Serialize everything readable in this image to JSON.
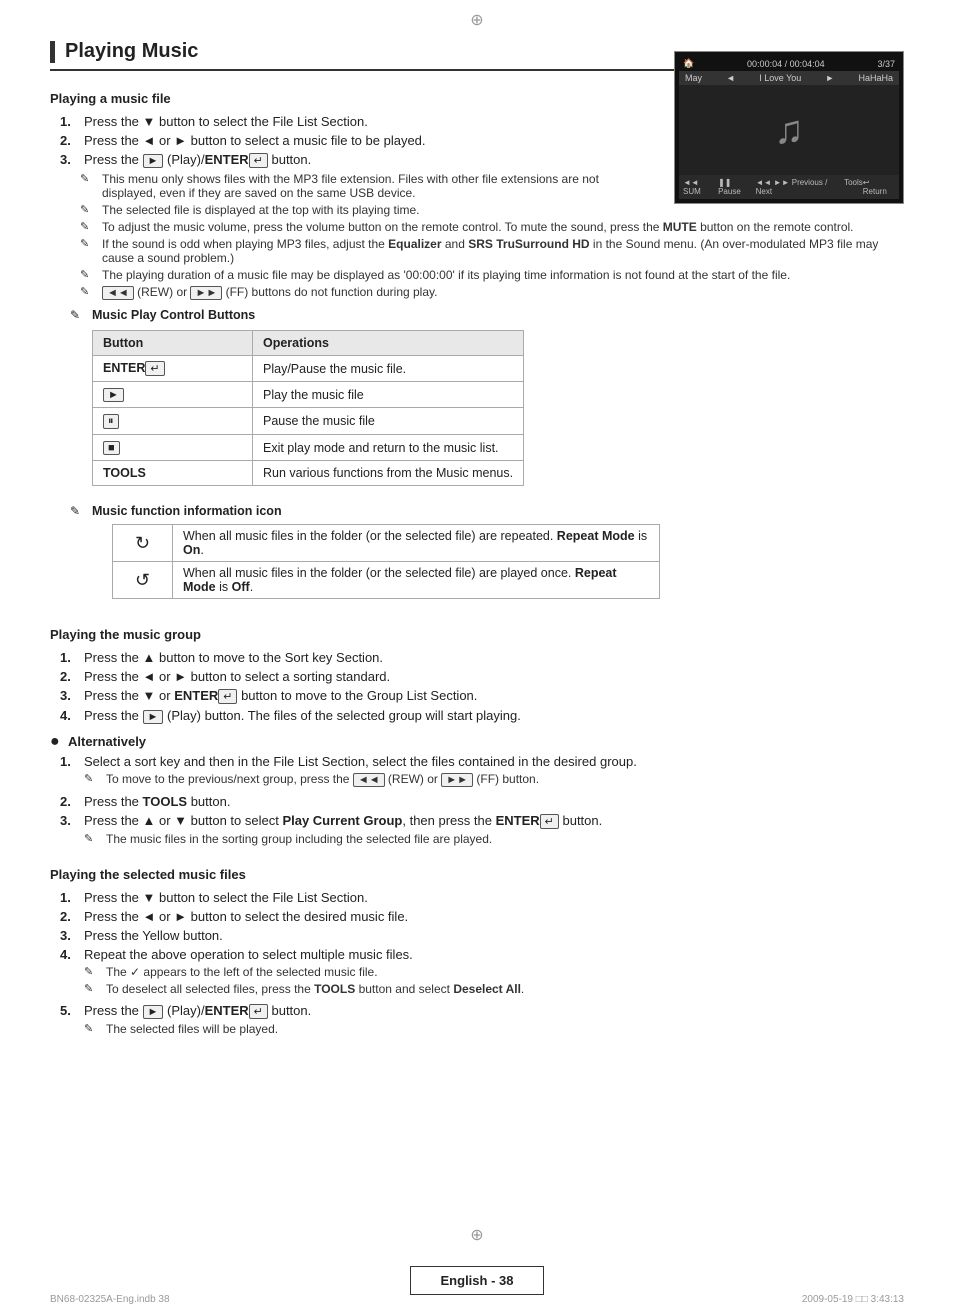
{
  "page": {
    "title": "Playing Music",
    "crosshair_symbol": "⊕",
    "footer": {
      "label": "English - 38",
      "meta_left": "BN68-02325A-Eng.indb   38",
      "meta_right": "2009-05-19   □□ 3:43:13"
    }
  },
  "sections": {
    "playing_music_file": {
      "title": "Playing a music file",
      "steps": [
        {
          "num": "1.",
          "text": "Press the ▼ button to select the File List Section."
        },
        {
          "num": "2.",
          "text": "Press the ◄ or ► button to select a music file to be played."
        },
        {
          "num": "3.",
          "text": "Press the  (Play)/ENTER  button."
        }
      ],
      "notes": [
        "This menu only shows files with the MP3 file extension. Files with other file extensions are not displayed, even if they are saved on the same USB device.",
        "The selected file is displayed at the top with its playing time.",
        "To adjust the music volume, press the volume button on the remote control. To mute the sound, press the MUTE button on the remote control.",
        "If the sound is odd when playing MP3 files, adjust the Equalizer and SRS TruSurround HD in the Sound menu. (An over-modulated MP3 file may cause a sound problem.)",
        "The playing duration of a music file may be displayed as '00:00:00' if its playing time information is not found at the start of the file.",
        " (REW) or  (FF) buttons do not function during play."
      ]
    },
    "music_play_control": {
      "title": "Music Play Control Buttons",
      "table_headers": [
        "Button",
        "Operations"
      ],
      "table_rows": [
        {
          "button": "ENTER",
          "operation": "Play/Pause the music file."
        },
        {
          "button": "▶",
          "operation": "Play the music file"
        },
        {
          "button": "⏸",
          "operation": "Pause the music file"
        },
        {
          "button": "■",
          "operation": "Exit play mode and return to the music list."
        },
        {
          "button": "TOOLS",
          "operation": "Run various functions from the Music menus."
        }
      ]
    },
    "music_function_icon": {
      "title": "Music function information icon",
      "rows": [
        {
          "icon": "↻",
          "description": "When all music files in the folder (or the selected file) are repeated. Repeat Mode is On."
        },
        {
          "icon": "↺",
          "description": "When all music files in the folder (or the selected file) are played once. Repeat Mode is Off."
        }
      ]
    },
    "playing_music_group": {
      "title": "Playing the music group",
      "steps": [
        {
          "num": "1.",
          "text": "Press the ▲ button to move to the Sort key Section."
        },
        {
          "num": "2.",
          "text": "Press the ◄ or ► button to select a sorting standard."
        },
        {
          "num": "3.",
          "text": "Press the ▼ or ENTER  button to move to the Group List Section."
        },
        {
          "num": "4.",
          "text": "Press the  (Play) button. The files of the selected group will start playing."
        }
      ],
      "alternatively_title": "Alternatively",
      "alt_steps": [
        {
          "num": "1.",
          "text": "Select a sort key and then in the File List Section, select the files contained in the desired group.",
          "note": "To move to the previous/next group, press the  (REW) or  (FF) button."
        },
        {
          "num": "2.",
          "text": "Press the TOOLS button."
        },
        {
          "num": "3.",
          "text": "Press the ▲ or ▼ button to select Play Current Group, then press the ENTER  button.",
          "note": "The music files in the sorting group including the selected file are played."
        }
      ]
    },
    "playing_selected_music": {
      "title": "Playing the selected music files",
      "steps": [
        {
          "num": "1.",
          "text": "Press the ▼ button to select the File List Section."
        },
        {
          "num": "2.",
          "text": "Press the ◄ or ► button to select the desired music file."
        },
        {
          "num": "3.",
          "text": "Press the Yellow button."
        },
        {
          "num": "4.",
          "text": "Repeat the above operation to select multiple music files.",
          "notes": [
            "The  ✓  appears to the left of the selected music file.",
            "To deselect all selected files, press the TOOLS button and select Deselect All."
          ]
        },
        {
          "num": "5.",
          "text": "Press the  (Play)/ENTER  button.",
          "note": "The selected files will be played."
        }
      ]
    }
  },
  "screenshot": {
    "time": "00:00:04 / 00:04:04",
    "track_num": "3/37",
    "track_artist": "May",
    "track_name": "I Love You",
    "track_album": "HaHaHa",
    "controls": [
      "◄◄ SUM",
      "❚❚ Pause",
      "◄◄ ►► Previous / Next",
      "Tools",
      "↩ Return"
    ]
  }
}
